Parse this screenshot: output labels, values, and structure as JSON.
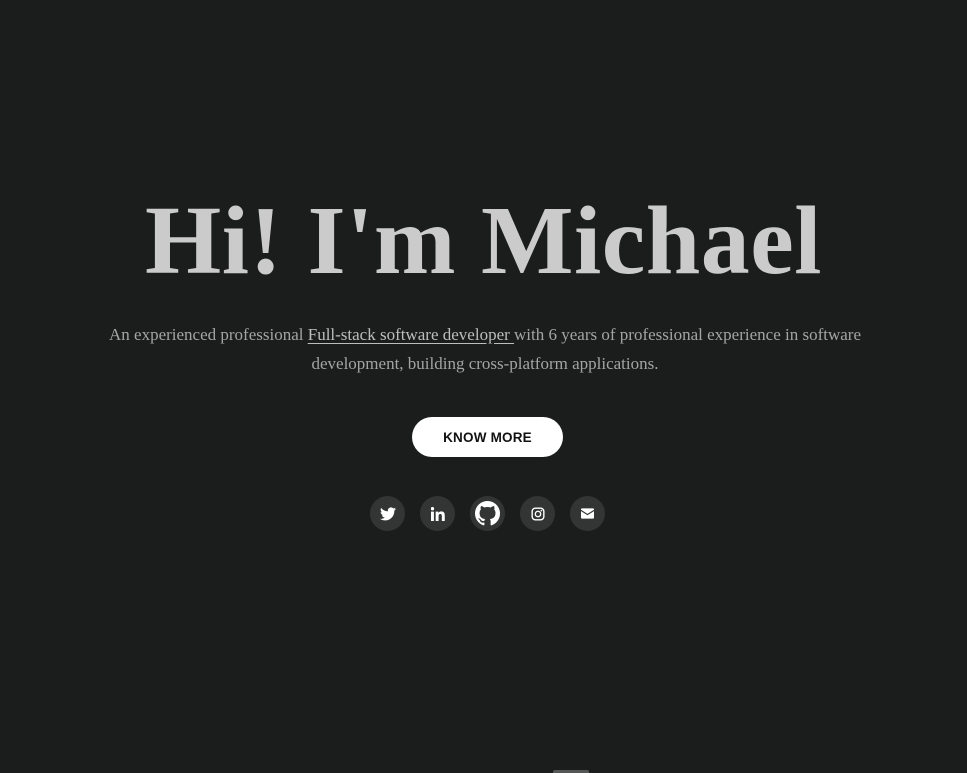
{
  "hero": {
    "title": "Hi! I'm Michael",
    "intro_before": "An experienced professional ",
    "intro_link": "Full-stack software developer ",
    "intro_after": "with 6 years of professional experience in software development, building cross-platform applications.",
    "cta_label": "KNOW MORE"
  },
  "socials": [
    {
      "icon": "twitter-icon"
    },
    {
      "icon": "linkedin-icon"
    },
    {
      "icon": "github-icon"
    },
    {
      "icon": "instagram-icon"
    },
    {
      "icon": "mail-icon"
    }
  ],
  "colors": {
    "background": "#1b1c1c",
    "title": "#cbcbcb",
    "body_text": "#a4a4a4",
    "button_bg": "#ffffff",
    "social_bg": "#333434"
  }
}
